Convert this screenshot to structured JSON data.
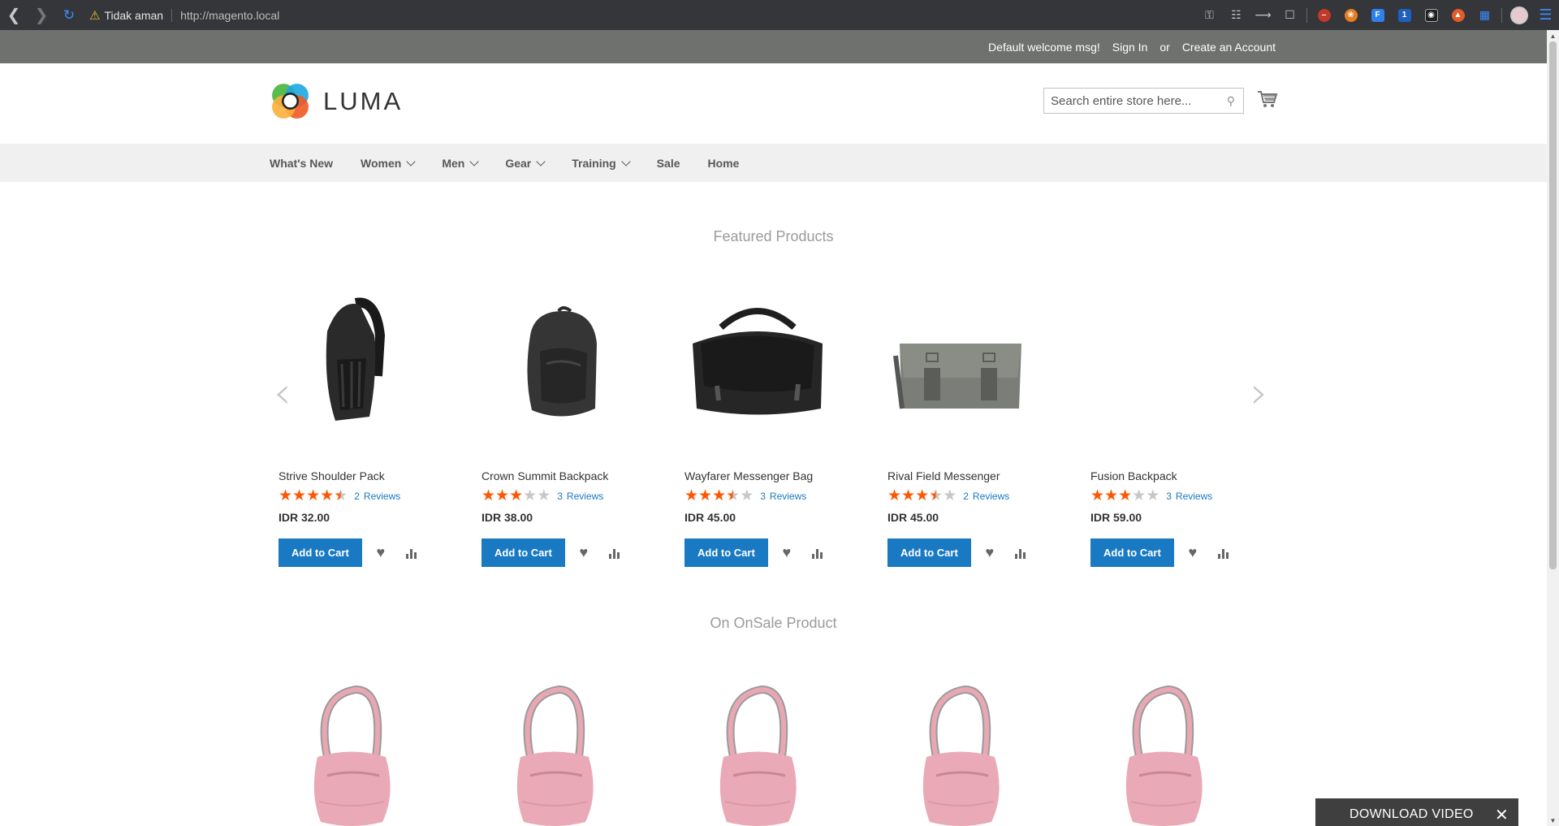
{
  "browser": {
    "security_label": "Tidak aman",
    "url": "http://magento.local",
    "extension_badge": "1"
  },
  "header": {
    "welcome": "Default welcome msg!",
    "sign_in": "Sign In",
    "or": "or",
    "create_account": "Create an Account",
    "logo_text": "LUMA",
    "search_placeholder": "Search entire store here..."
  },
  "nav": {
    "items": [
      {
        "label": "What's New",
        "has_children": false
      },
      {
        "label": "Women",
        "has_children": true
      },
      {
        "label": "Men",
        "has_children": true
      },
      {
        "label": "Gear",
        "has_children": true
      },
      {
        "label": "Training",
        "has_children": true
      },
      {
        "label": "Sale",
        "has_children": false
      },
      {
        "label": "Home",
        "has_children": false
      }
    ]
  },
  "featured": {
    "title": "Featured Products",
    "products": [
      {
        "name": "Strive Shoulder Pack",
        "rating": 4.5,
        "review_count": "2",
        "reviews_label": "Reviews",
        "price": "IDR 32.00",
        "add_label": "Add to Cart",
        "image": "sling-backpack-black"
      },
      {
        "name": "Crown Summit Backpack",
        "rating": 3,
        "review_count": "3",
        "reviews_label": "Reviews",
        "price": "IDR 38.00",
        "add_label": "Add to Cart",
        "image": "backpack-black"
      },
      {
        "name": "Wayfarer Messenger Bag",
        "rating": 3.5,
        "review_count": "3",
        "reviews_label": "Reviews",
        "price": "IDR 45.00",
        "add_label": "Add to Cart",
        "image": "messenger-bag-black"
      },
      {
        "name": "Rival Field Messenger",
        "rating": 3.5,
        "review_count": "2",
        "reviews_label": "Reviews",
        "price": "IDR 45.00",
        "add_label": "Add to Cart",
        "image": "messenger-bag-gray"
      },
      {
        "name": "Fusion Backpack",
        "rating": 3,
        "review_count": "3",
        "reviews_label": "Reviews",
        "price": "IDR 59.00",
        "add_label": "Add to Cart",
        "image": "none"
      }
    ]
  },
  "onsale": {
    "title": "On OnSale Product",
    "products": [
      {
        "image": "pink-shoulder-bag"
      },
      {
        "image": "pink-shoulder-bag"
      },
      {
        "image": "pink-shoulder-bag"
      },
      {
        "image": "pink-shoulder-bag"
      },
      {
        "image": "pink-shoulder-bag"
      }
    ]
  },
  "overlay": {
    "download_label": "DOWNLOAD VIDEO",
    "close": "✕"
  },
  "colors": {
    "primary_blue": "#1979c3",
    "star_orange": "#ff5501",
    "panel_gray": "#6e716e"
  }
}
